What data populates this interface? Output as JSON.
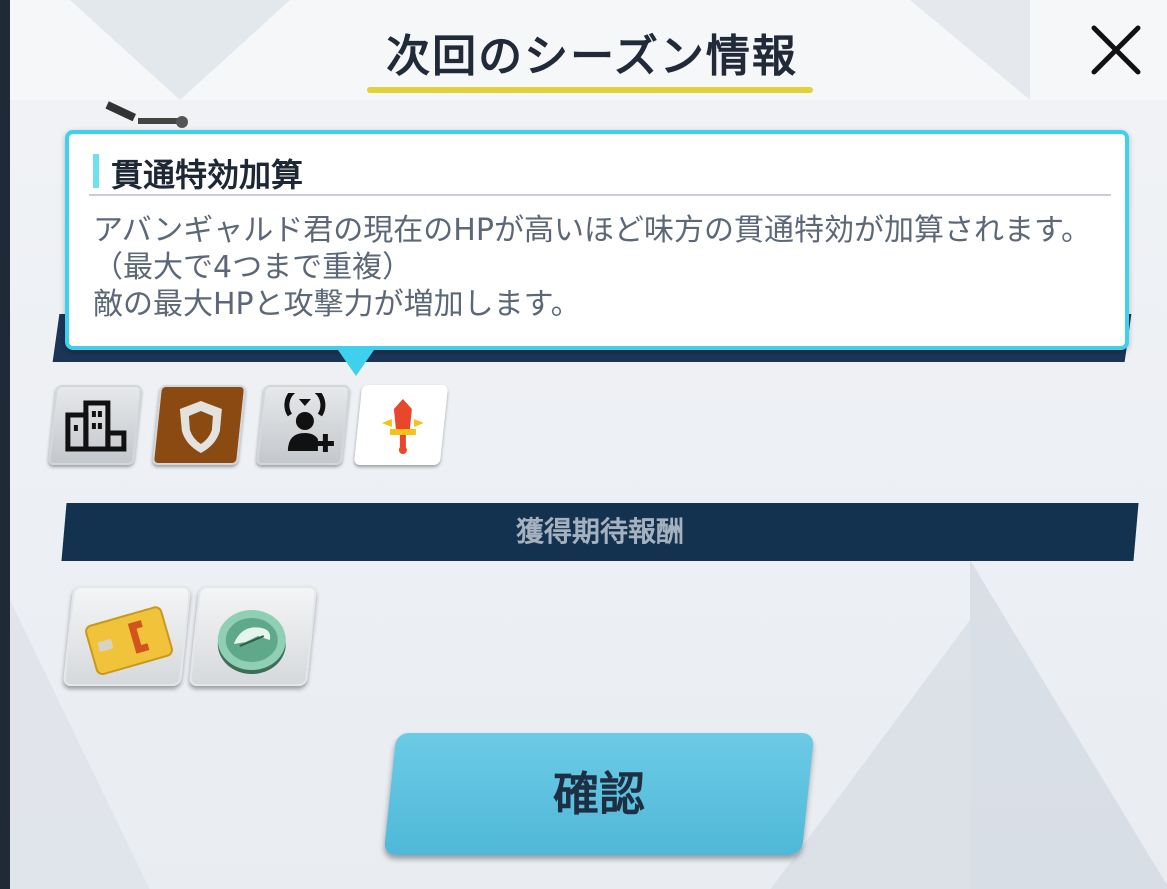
{
  "header": {
    "title": "次回のシーズン情報",
    "close_icon": "close-icon"
  },
  "tooltip": {
    "title": "貫通特効加算",
    "body_line1": "アバンギャルド君の現在のHPが高いほど味方の貫通特効が加算されます。（最大で4つまで重複）",
    "body_line2": "敵の最大HPと攻撃力が増加します。"
  },
  "effect_icons": [
    {
      "name": "building-icon",
      "selected": false
    },
    {
      "name": "shield-icon",
      "selected": false
    },
    {
      "name": "target-person-plus-icon",
      "selected": false
    },
    {
      "name": "piercing-sword-icon",
      "selected": true
    }
  ],
  "rewards": {
    "header": "獲得期待報酬",
    "items": [
      {
        "name": "credit-card-icon"
      },
      {
        "name": "green-coin-icon"
      }
    ]
  },
  "confirm_button": {
    "label": "確認"
  },
  "colors": {
    "accent_cyan": "#3ed0ec",
    "title_underline": "#e1d23a",
    "section_header": "#13324f",
    "confirm_button": "#5cc0de"
  }
}
